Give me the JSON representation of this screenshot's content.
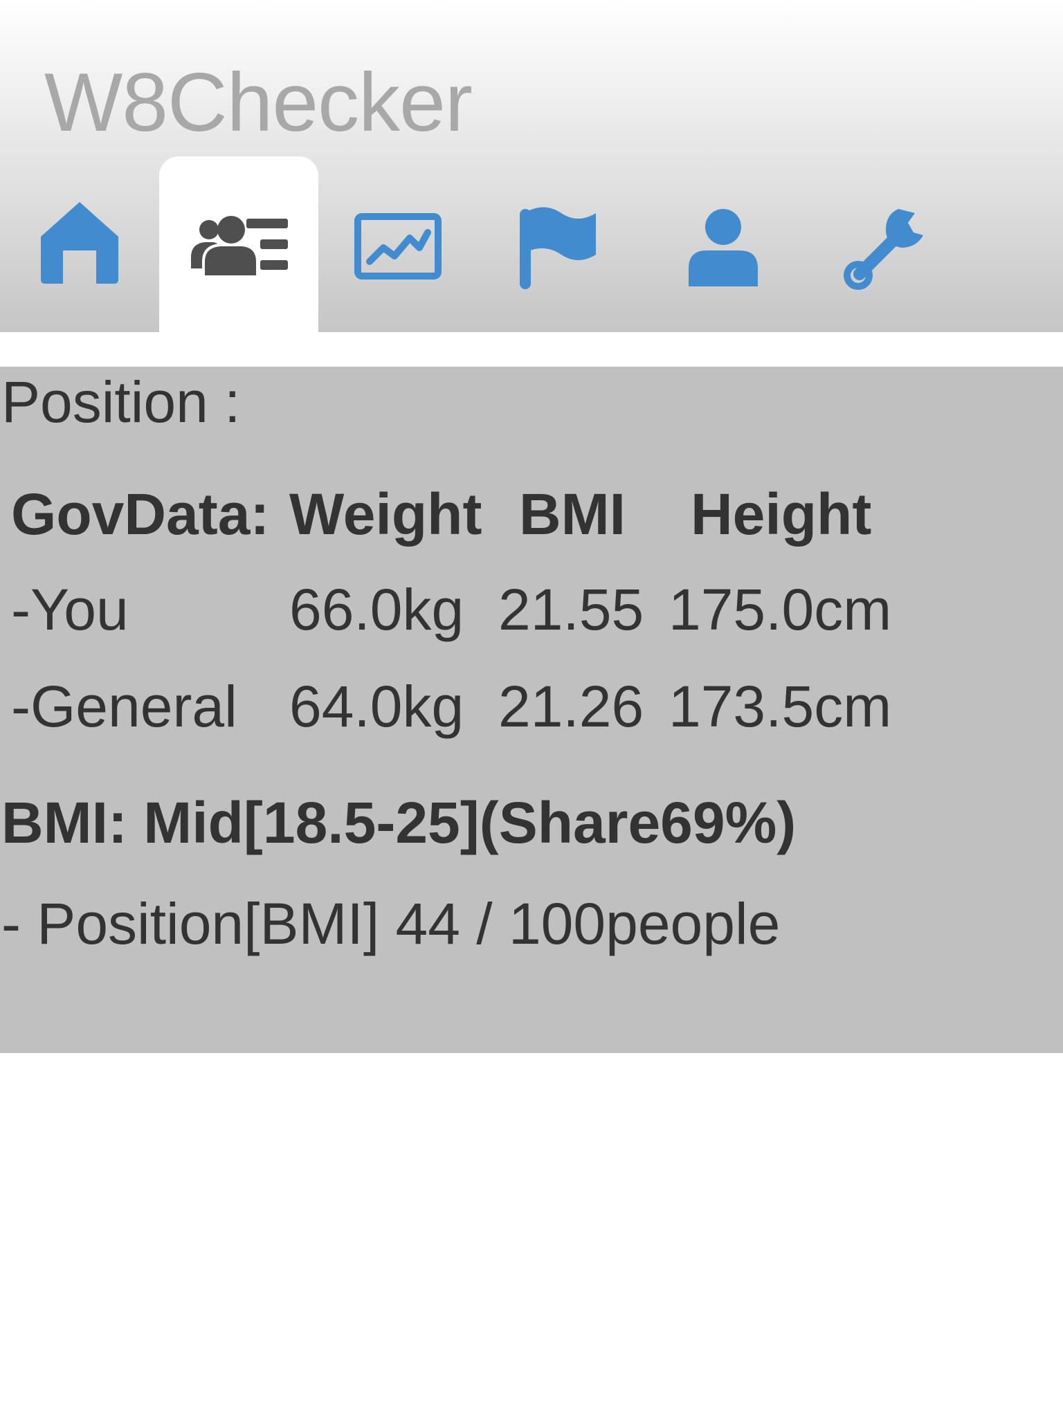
{
  "app": {
    "title": "W8Checker"
  },
  "tabs": [
    {
      "icon": "home-icon",
      "active": false
    },
    {
      "icon": "user-list-icon",
      "active": true
    },
    {
      "icon": "chart-icon",
      "active": false
    },
    {
      "icon": "flag-icon",
      "active": false
    },
    {
      "icon": "user-icon",
      "active": false
    },
    {
      "icon": "wrench-icon",
      "active": false
    }
  ],
  "colors": {
    "tab_icon": "#428bcf",
    "active_tab_icon": "#4f4f4f",
    "title": "#a8a8a8",
    "panel_bg": "#c0c0c0",
    "text": "#333333"
  },
  "position": {
    "heading": "Position :",
    "table": {
      "headers": [
        "GovData:",
        "Weight",
        "BMI",
        "Height"
      ],
      "rows": [
        {
          "label": "-You",
          "weight": "66.0kg",
          "bmi": "21.55",
          "height": "175.0cm"
        },
        {
          "label": "-General",
          "weight": "64.0kg",
          "bmi": "21.26",
          "height": "173.5cm"
        }
      ]
    },
    "bmi_summary": "BMI: Mid[18.5-25](Share69%)",
    "rank": "- Position[BMI] 44 / 100people"
  }
}
